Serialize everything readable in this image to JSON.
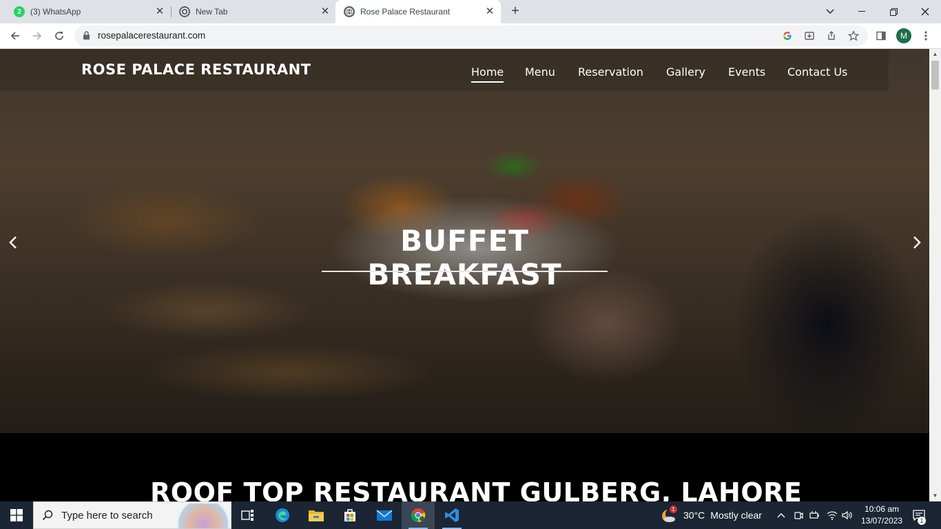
{
  "browser": {
    "tabs": [
      {
        "label": "(3) WhatsApp",
        "badge": "2"
      },
      {
        "label": "New Tab"
      },
      {
        "label": "Rose Palace Restaurant",
        "active": true
      }
    ],
    "url": "rosepalacerestaurant.com",
    "profile_initial": "M"
  },
  "site": {
    "brand": "ROSE PALACE RESTAURANT",
    "nav": [
      {
        "label": "Home",
        "active": true
      },
      {
        "label": "Menu"
      },
      {
        "label": "Reservation"
      },
      {
        "label": "Gallery"
      },
      {
        "label": "Events"
      },
      {
        "label": "Contact Us"
      }
    ],
    "hero_title": "BUFFET BREAKFAST",
    "section_title": "ROOF TOP RESTAURANT GULBERG, LAHORE"
  },
  "taskbar": {
    "search_placeholder": "Type here to search",
    "weather_temp": "30°C",
    "weather_desc": "Mostly clear",
    "weather_badge": "1",
    "time": "10:06 am",
    "date": "13/07/2023",
    "notification_count": "1"
  },
  "colors": {
    "tabstrip": "#dee1e6",
    "taskbar": "#1c2533",
    "whatsapp": "#25d366",
    "profile": "#1e6e4b"
  }
}
